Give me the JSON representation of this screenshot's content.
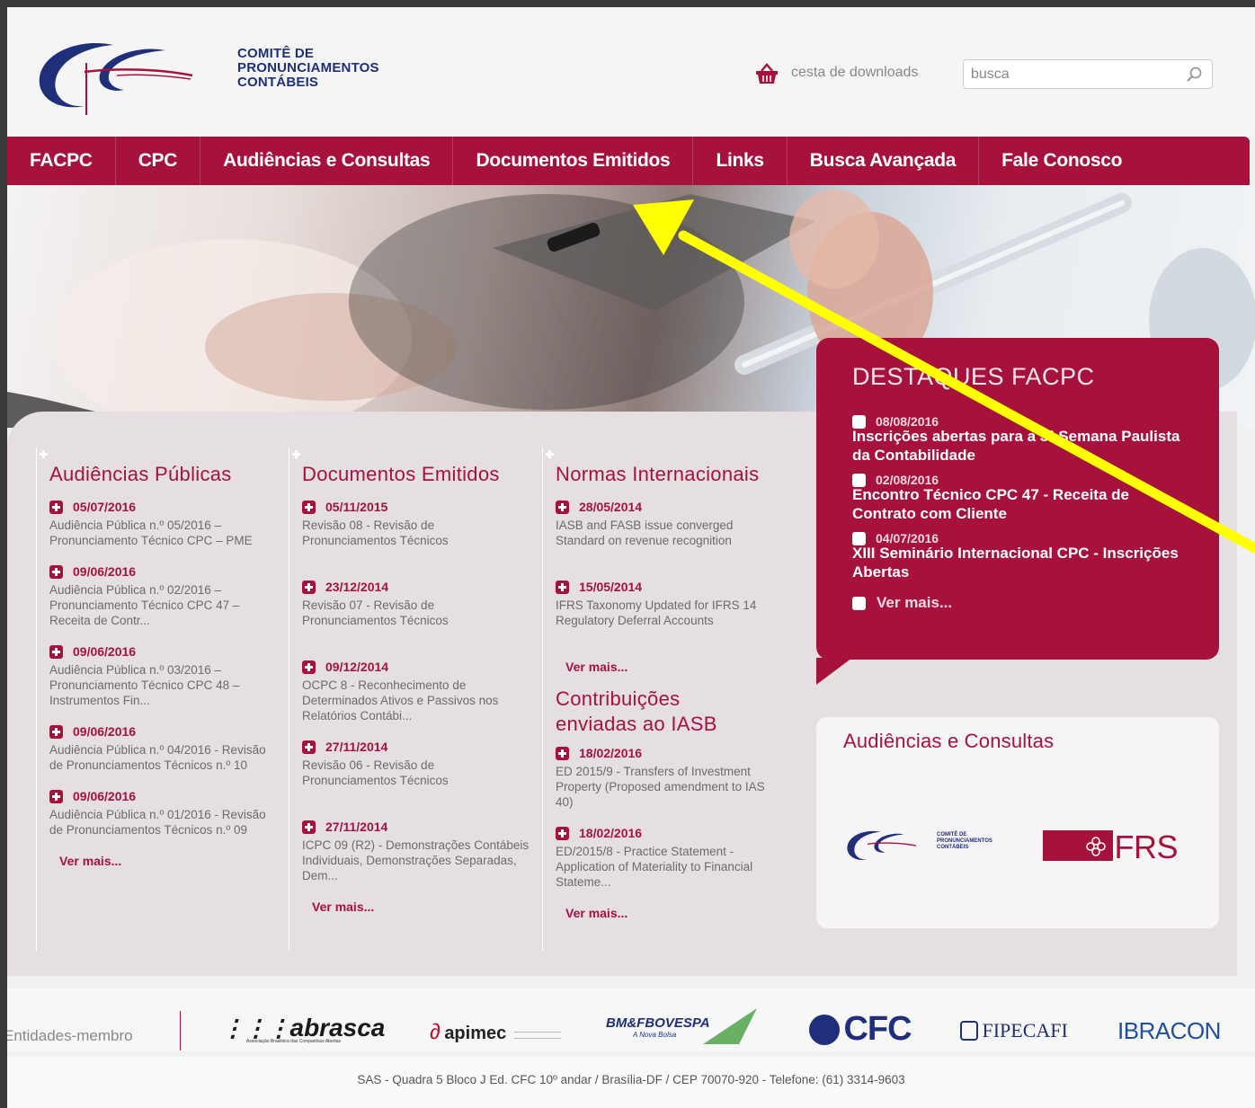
{
  "header": {
    "org_name": [
      "COMITÊ DE",
      "PRONUNCIAMENTOS",
      "CONTÁBEIS"
    ],
    "basket_label": "cesta de downloads",
    "search_placeholder": "busca"
  },
  "nav": {
    "items": [
      "FACPC",
      "CPC",
      "Audiências e Consultas",
      "Documentos Emitidos",
      "Links",
      "Busca Avançada",
      "Fale Conosco"
    ]
  },
  "columns": {
    "audiencias": {
      "title": "Audiências Públicas",
      "items": [
        {
          "date": "05/07/2016",
          "text": "Audiência Pública n.º 05/2016 – Pronunciamento Técnico CPC – PME"
        },
        {
          "date": "09/06/2016",
          "text": "Audiência Pública n.º 02/2016 – Pronunciamento Técnico CPC 47 – Receita de Contr..."
        },
        {
          "date": "09/06/2016",
          "text": "Audiência Pública n.º 03/2016 – Pronunciamento Técnico CPC 48 – Instrumentos Fin..."
        },
        {
          "date": "09/06/2016",
          "text": "Audiência Pública n.º 04/2016 - Revisão de Pronunciamentos Técnicos n.º 10"
        },
        {
          "date": "09/06/2016",
          "text": "Audiência Pública n.º 01/2016 - Revisão de Pronunciamentos Técnicos n.º 09"
        }
      ],
      "more": "Ver mais..."
    },
    "documentos": {
      "title": "Documentos Emitidos",
      "items": [
        {
          "date": "05/11/2015",
          "text": "Revisão 08 - Revisão de Pronunciamentos Técnicos"
        },
        {
          "date": "23/12/2014",
          "text": "Revisão 07 - Revisão de Pronunciamentos Técnicos"
        },
        {
          "date": "09/12/2014",
          "text": "OCPC 8 - Reconhecimento de Determinados Ativos e Passivos nos Relatórios Contábi..."
        },
        {
          "date": "27/11/2014",
          "text": "Revisão 06 - Revisão de Pronunciamentos Técnicos"
        },
        {
          "date": "27/11/2014",
          "text": "ICPC 09 (R2) - Demonstrações Contábeis Individuais, Demonstrações Separadas, Dem..."
        }
      ],
      "more": "Ver mais..."
    },
    "normas": {
      "title": "Normas Internacionais",
      "items": [
        {
          "date": "28/05/2014",
          "text": "IASB and FASB issue converged Standard on revenue recognition"
        },
        {
          "date": "15/05/2014",
          "text": "IFRS Taxonomy Updated for IFRS 14 Regulatory Deferral Accounts"
        }
      ],
      "more": "Ver mais..."
    },
    "contribuicoes": {
      "title": "Contribuições enviadas ao IASB",
      "items": [
        {
          "date": "18/02/2016",
          "text": "ED 2015/9 - Transfers of Investment Property (Proposed amendment to IAS 40)"
        },
        {
          "date": "18/02/2016",
          "text": "ED/2015/8 - Practice Statement - Application of Materiality to Financial Stateme..."
        }
      ],
      "more": "Ver mais..."
    }
  },
  "destaques": {
    "title": "DESTAQUES FACPC",
    "items": [
      {
        "date": "08/08/2016",
        "text": "Inscrições abertas para a 3ª Semana Paulista da Contabilidade"
      },
      {
        "date": "02/08/2016",
        "text": "Encontro Técnico CPC 47 - Receita de Contrato com Cliente"
      },
      {
        "date": "04/07/2016",
        "text": "XIII Seminário Internacional CPC - Inscrições Abertas"
      }
    ],
    "more": "Ver mais..."
  },
  "aud_box": {
    "title": "Audiências e Consultas",
    "cpc_small": [
      "COMITÊ DE",
      "PRONUNCIAMENTOS",
      "CONTÁBEIS"
    ],
    "ifrs": "IFRS"
  },
  "members": {
    "label": "Entidades-membro",
    "logos": [
      "abrasca",
      "apimec",
      "BM&FBOVESPA",
      "CFC",
      "FIPECAFI",
      "IBRACON"
    ],
    "abrasca_sub": "Associação Brasileira das Companhias Abertas",
    "bovespa_sub": "A Nova Bolsa"
  },
  "footer": {
    "address": "SAS - Quadra 5 Bloco J Ed. CFC 10º andar / Brasília-DF / CEP 70070-920 - Telefone: (61) 3314-9603"
  },
  "colors": {
    "brand": "#a7123d",
    "navy": "#1f2f7a",
    "arrow": "#ffff00"
  }
}
